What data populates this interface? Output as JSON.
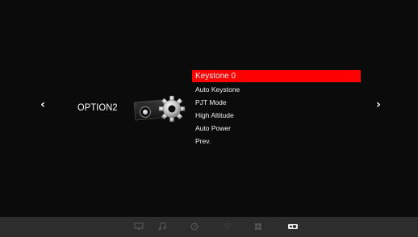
{
  "nav": {
    "prev_symbol": "‹",
    "next_symbol": "›"
  },
  "section": {
    "title": "OPTION2"
  },
  "menu": {
    "items": [
      {
        "label": "Keystone 0",
        "selected": true
      },
      {
        "label": "Auto Keystone",
        "selected": false
      },
      {
        "label": "PJT Mode",
        "selected": false
      },
      {
        "label": "High Altitude",
        "selected": false
      },
      {
        "label": "Auto Power",
        "selected": false
      },
      {
        "label": "Prev.",
        "selected": false
      }
    ]
  },
  "bottom_bar": {
    "icons": [
      "monitor-icon",
      "music-icon",
      "clock-icon",
      "wifi-icon",
      "apps-grid-icon",
      "projector-settings-icon"
    ],
    "active_icon": "projector-settings-icon"
  },
  "colors": {
    "accent": "#ff0000",
    "background": "#0b0b0b",
    "bottom_bar": "#2d2d2d",
    "inactive_icon": "#555555"
  }
}
